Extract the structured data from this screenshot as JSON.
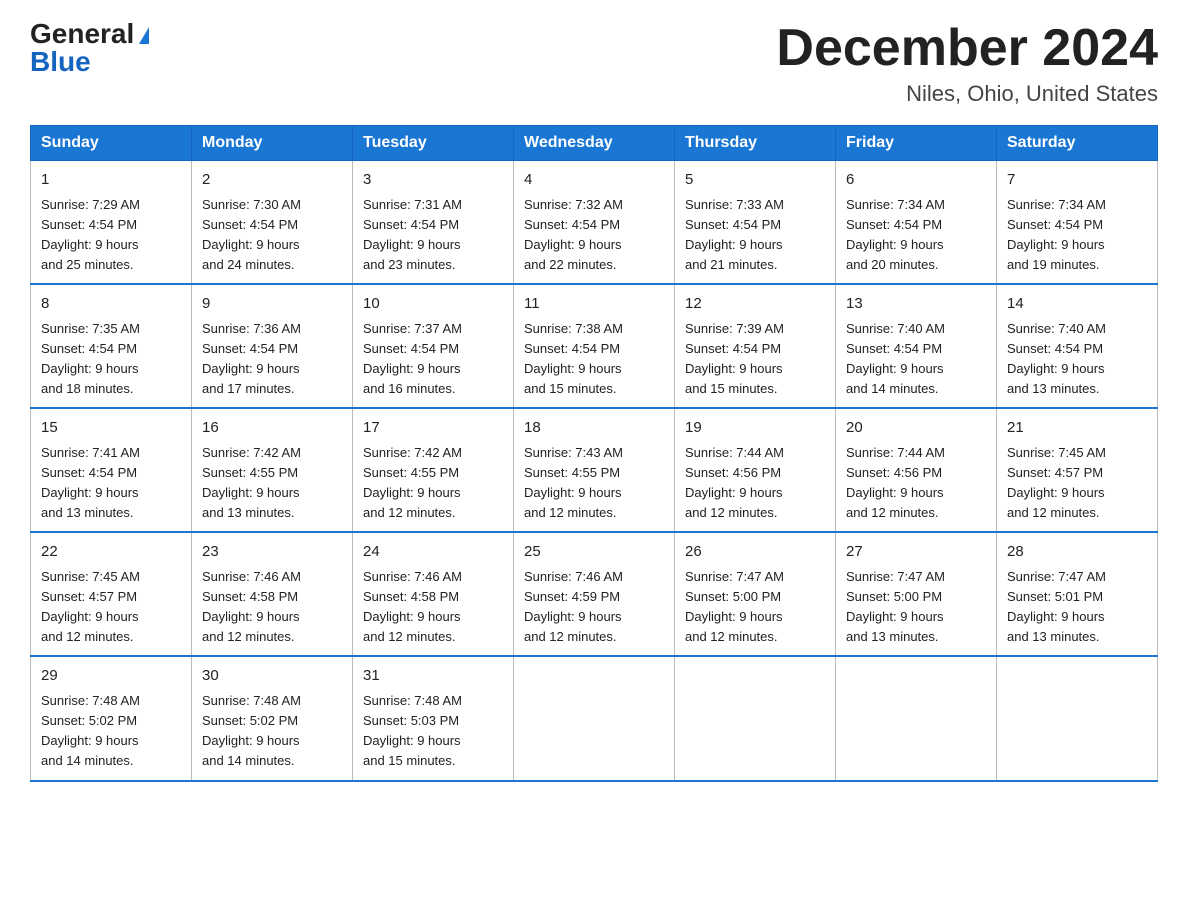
{
  "header": {
    "logo_general": "General",
    "logo_blue": "Blue",
    "month_title": "December 2024",
    "location": "Niles, Ohio, United States"
  },
  "days_of_week": [
    "Sunday",
    "Monday",
    "Tuesday",
    "Wednesday",
    "Thursday",
    "Friday",
    "Saturday"
  ],
  "weeks": [
    [
      {
        "num": "1",
        "sunrise": "7:29 AM",
        "sunset": "4:54 PM",
        "daylight": "9 hours and 25 minutes."
      },
      {
        "num": "2",
        "sunrise": "7:30 AM",
        "sunset": "4:54 PM",
        "daylight": "9 hours and 24 minutes."
      },
      {
        "num": "3",
        "sunrise": "7:31 AM",
        "sunset": "4:54 PM",
        "daylight": "9 hours and 23 minutes."
      },
      {
        "num": "4",
        "sunrise": "7:32 AM",
        "sunset": "4:54 PM",
        "daylight": "9 hours and 22 minutes."
      },
      {
        "num": "5",
        "sunrise": "7:33 AM",
        "sunset": "4:54 PM",
        "daylight": "9 hours and 21 minutes."
      },
      {
        "num": "6",
        "sunrise": "7:34 AM",
        "sunset": "4:54 PM",
        "daylight": "9 hours and 20 minutes."
      },
      {
        "num": "7",
        "sunrise": "7:34 AM",
        "sunset": "4:54 PM",
        "daylight": "9 hours and 19 minutes."
      }
    ],
    [
      {
        "num": "8",
        "sunrise": "7:35 AM",
        "sunset": "4:54 PM",
        "daylight": "9 hours and 18 minutes."
      },
      {
        "num": "9",
        "sunrise": "7:36 AM",
        "sunset": "4:54 PM",
        "daylight": "9 hours and 17 minutes."
      },
      {
        "num": "10",
        "sunrise": "7:37 AM",
        "sunset": "4:54 PM",
        "daylight": "9 hours and 16 minutes."
      },
      {
        "num": "11",
        "sunrise": "7:38 AM",
        "sunset": "4:54 PM",
        "daylight": "9 hours and 15 minutes."
      },
      {
        "num": "12",
        "sunrise": "7:39 AM",
        "sunset": "4:54 PM",
        "daylight": "9 hours and 15 minutes."
      },
      {
        "num": "13",
        "sunrise": "7:40 AM",
        "sunset": "4:54 PM",
        "daylight": "9 hours and 14 minutes."
      },
      {
        "num": "14",
        "sunrise": "7:40 AM",
        "sunset": "4:54 PM",
        "daylight": "9 hours and 13 minutes."
      }
    ],
    [
      {
        "num": "15",
        "sunrise": "7:41 AM",
        "sunset": "4:54 PM",
        "daylight": "9 hours and 13 minutes."
      },
      {
        "num": "16",
        "sunrise": "7:42 AM",
        "sunset": "4:55 PM",
        "daylight": "9 hours and 13 minutes."
      },
      {
        "num": "17",
        "sunrise": "7:42 AM",
        "sunset": "4:55 PM",
        "daylight": "9 hours and 12 minutes."
      },
      {
        "num": "18",
        "sunrise": "7:43 AM",
        "sunset": "4:55 PM",
        "daylight": "9 hours and 12 minutes."
      },
      {
        "num": "19",
        "sunrise": "7:44 AM",
        "sunset": "4:56 PM",
        "daylight": "9 hours and 12 minutes."
      },
      {
        "num": "20",
        "sunrise": "7:44 AM",
        "sunset": "4:56 PM",
        "daylight": "9 hours and 12 minutes."
      },
      {
        "num": "21",
        "sunrise": "7:45 AM",
        "sunset": "4:57 PM",
        "daylight": "9 hours and 12 minutes."
      }
    ],
    [
      {
        "num": "22",
        "sunrise": "7:45 AM",
        "sunset": "4:57 PM",
        "daylight": "9 hours and 12 minutes."
      },
      {
        "num": "23",
        "sunrise": "7:46 AM",
        "sunset": "4:58 PM",
        "daylight": "9 hours and 12 minutes."
      },
      {
        "num": "24",
        "sunrise": "7:46 AM",
        "sunset": "4:58 PM",
        "daylight": "9 hours and 12 minutes."
      },
      {
        "num": "25",
        "sunrise": "7:46 AM",
        "sunset": "4:59 PM",
        "daylight": "9 hours and 12 minutes."
      },
      {
        "num": "26",
        "sunrise": "7:47 AM",
        "sunset": "5:00 PM",
        "daylight": "9 hours and 12 minutes."
      },
      {
        "num": "27",
        "sunrise": "7:47 AM",
        "sunset": "5:00 PM",
        "daylight": "9 hours and 13 minutes."
      },
      {
        "num": "28",
        "sunrise": "7:47 AM",
        "sunset": "5:01 PM",
        "daylight": "9 hours and 13 minutes."
      }
    ],
    [
      {
        "num": "29",
        "sunrise": "7:48 AM",
        "sunset": "5:02 PM",
        "daylight": "9 hours and 14 minutes."
      },
      {
        "num": "30",
        "sunrise": "7:48 AM",
        "sunset": "5:02 PM",
        "daylight": "9 hours and 14 minutes."
      },
      {
        "num": "31",
        "sunrise": "7:48 AM",
        "sunset": "5:03 PM",
        "daylight": "9 hours and 15 minutes."
      },
      null,
      null,
      null,
      null
    ]
  ],
  "labels": {
    "sunrise": "Sunrise:",
    "sunset": "Sunset:",
    "daylight": "Daylight:"
  }
}
